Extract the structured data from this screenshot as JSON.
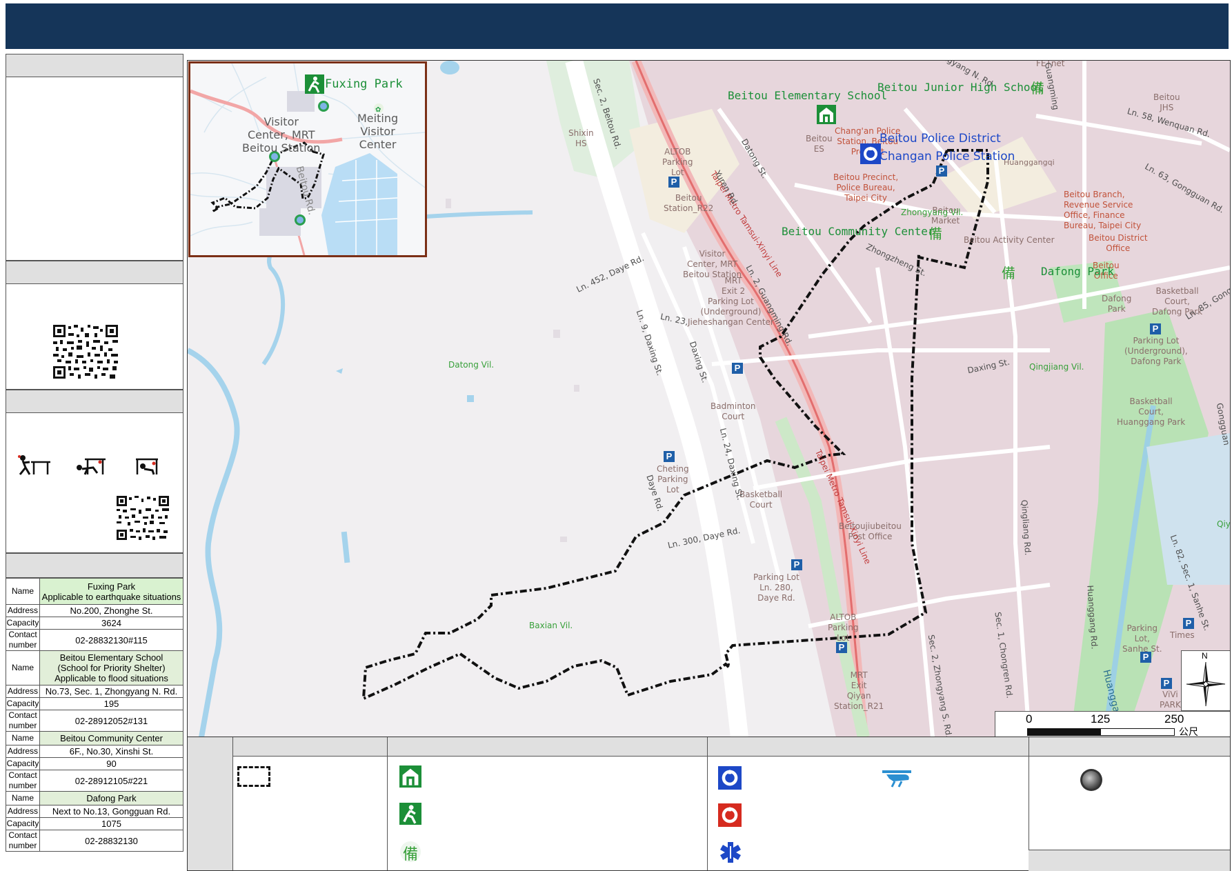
{
  "map": {
    "labels": {
      "shixin_hs": "Shixin\nHS",
      "altob_parking_1": "ALTOB\nParking\nLot",
      "beitou_station_r22": "Beitou\nStation_R22",
      "visitor_center_mrt": "Visitor\nCenter, MRT\nBeitou Station",
      "mrt_exit2": "MRT\nExit 2",
      "parking_underground_1": "Parking Lot\n(Underground)\nJieheshangan Center",
      "badminton_court": "Badminton\nCourt",
      "cheting_parking": "Cheting\nParking\nLot",
      "basketball_court_1": "Basketball\nCourt",
      "beitou_post_office": "Beitoujiubeitou\nPost Office",
      "parking_ln280": "Parking Lot\nLn. 280,\nDaye Rd.",
      "altob_parking_2": "ALTOB\nParking\nLot",
      "mrt_exit_qiyan": "MRT\nExit\nQiyan\nStation_R21",
      "beitou_es": "Beitou\nES",
      "changan_police_precinct": "Chang'an Police\nStation, Beitou\nPrecinct",
      "beitou_precinct_bureau": "Beitou Precinct,\nPolice Bureau,\nTaipei City",
      "beitou_market": "Beitou\nMarket",
      "beitou_activity_center": "Beitou Activity Center",
      "revenue_service": "Beitou Branch,\nRevenue Service\nOffice, Finance\nBureau, Taipei City",
      "beitou_district_office": "Beitou District\nOffice",
      "beitou_office": "Beitou\nOffice",
      "dafong_park_small": "Dafong\nPark",
      "basketball_dafong": "Basketball\nCourt,\nDafong Park",
      "parking_dafong": "Parking Lot\n(Underground),\nDafong Park",
      "basketball_huanggang": "Basketball\nCourt,\nHuanggang Park",
      "parking_sanhe": "Parking\nLot,\nSanhe St.",
      "times": "Times",
      "vivi_park": "ViVi\nPARK",
      "huanggangqi": "Huanggangqi",
      "beitou_jhs_small": "Beitou\nJHS",
      "fetnet": "FETnet"
    },
    "villages": {
      "datong": "Datong Vil.",
      "baxian": "Baxian Vil.",
      "zhongyang": "Zhongyang Vil.",
      "qingjiang": "Qingjiang Vil."
    },
    "roads": {
      "sec2_beitou": "Sec. 2, Beitou Rd.",
      "metro_line_1": "Taipei Metro Tamsui-Xinyi Line",
      "metro_line_2": "Taipei Metro Tamsui-Xinyi Line",
      "yuren": "Yuren Rd.",
      "datong_st": "Datong St.",
      "ln452_daye": "Ln. 452, Daye Rd.",
      "ln9_daxing": "Ln. 9, Daxing St.",
      "ln23": "Ln. 23,",
      "daxing_st": "Daxing St.",
      "daxing_st2": "Daxing St.",
      "ln24_daxing": "Ln. 24, Daxing St.",
      "ln300_daye": "Ln. 300, Daye Rd.",
      "daye_rd": "Daye Rd.",
      "ln2_guangming": "Ln. 2, Guangming Rd.",
      "zhongzheng": "Zhongzheng St.",
      "qingliang": "Qingliang Rd.",
      "sec1_chongren": "Sec. 1, Chongren Rd.",
      "sec2_zhongyang": "Sec. 2, Zhongyang S. Rd.",
      "huanggang_rd": "Huanggang Rd.",
      "huanggang_rd2": "Huanggang Rd.",
      "ln82_sanhe": "Ln. 82, Sec. 1, Sanhe St.",
      "ln58_wenquan": "Ln. 58, Wenquan Rd.",
      "ln63_gongguan": "Ln. 63, Gongguan Rd.",
      "ln85": "Ln. 85, Gong",
      "gongguan": "Gongguan",
      "guangming": "Guangming",
      "zhongyang_n": "ngyang N. Rd.",
      "beitou_rd_inset": "Beitou Rd.",
      "qiy": "Qiy"
    },
    "shelters": {
      "beitou_es": "Beitou Elementary School",
      "beitou_jhs": "Beitou Junior High School",
      "community_center": "Beitou Community Center",
      "dafong_park": "Dafong Park"
    },
    "police": {
      "district": "Beitou Police District",
      "station": "Changan Police Station"
    },
    "inset": {
      "fuxing_park": "Fuxing Park",
      "meiting": "Meiting\nVisitor\nCenter",
      "visitor_center": "Visitor\nCenter, MRT\nBeitou Station"
    },
    "scale": {
      "ticks": [
        "0",
        "125",
        "250"
      ],
      "unit": "公尺"
    },
    "north": "N",
    "parking_mark": "P",
    "reserve_char": "備"
  },
  "shelter_table": {
    "keys": {
      "name": "Name",
      "address": "Address",
      "capacity": "Capacity",
      "contact": "Contact number"
    },
    "shelters": [
      {
        "name": "Fuxing Park\nApplicable to earthquake situations",
        "address": "No.200, Zhonghe St.",
        "capacity": "3624",
        "contact": "02-28832130#115"
      },
      {
        "name": "Beitou Elementary School\n(School for Priority Shelter)\nApplicable to flood situations",
        "address": "No.73, Sec. 1, Zhongyang N. Rd.",
        "capacity": "195",
        "contact": "02-28912052#131"
      },
      {
        "name": "Beitou  Community Center",
        "address": "6F., No.30, Xinshi St.",
        "capacity": "90",
        "contact": "02-28912105#221"
      },
      {
        "name": "Dafong Park",
        "address": "Next to No.13, Gongguan Rd.",
        "capacity": "1075",
        "contact": "02-28832130"
      }
    ]
  },
  "colors": {
    "header": "#153559",
    "shelter_green": "#1c8f38",
    "police_blue": "#1d48c7",
    "fire_red": "#d62b1f",
    "parking_blue": "#1f5fa8",
    "inset_border": "#7b2f16"
  }
}
